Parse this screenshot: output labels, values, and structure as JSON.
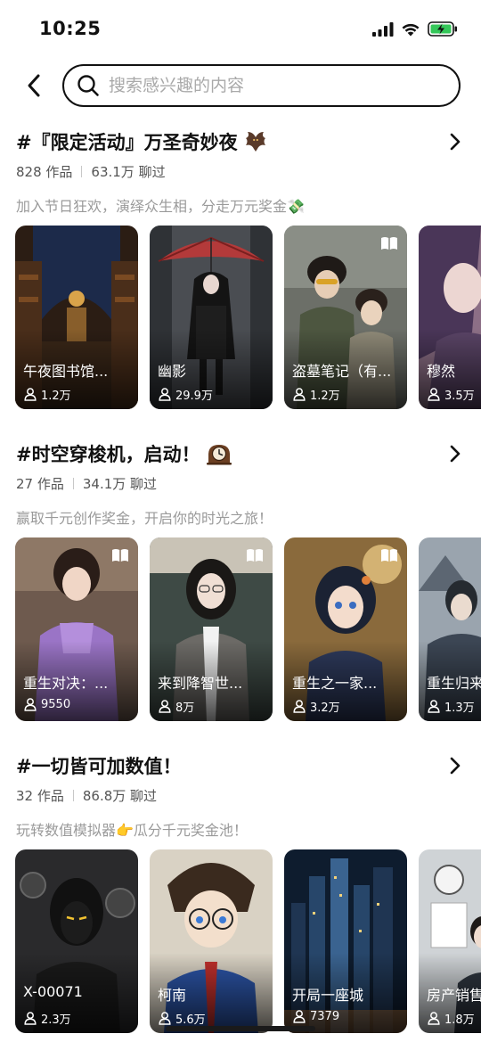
{
  "status_bar": {
    "time": "10:25"
  },
  "search": {
    "placeholder": "搜索感兴趣的内容",
    "value": ""
  },
  "topics": [
    {
      "title": "#『限定活动』万圣奇妙夜",
      "emoji_icon": "bat-icon",
      "works": "828 作品",
      "chats": "63.1万 聊过",
      "description": "加入节日狂欢，演绎众生相，分走万元奖金💸",
      "cards": [
        {
          "name": "午夜图书馆...",
          "count": "1.2万",
          "badge": false,
          "palette": "library"
        },
        {
          "name": "幽影",
          "count": "29.9万",
          "badge": false,
          "palette": "umbrella"
        },
        {
          "name": "盗墓笔记（有...",
          "count": "1.2万",
          "badge": true,
          "palette": "duo"
        },
        {
          "name": "穆然",
          "count": "3.5万",
          "badge": true,
          "palette": "mauve"
        }
      ]
    },
    {
      "title": "#时空穿梭机，启动！",
      "emoji_icon": "mantel-clock-icon",
      "works": "27 作品",
      "chats": "34.1万 聊过",
      "description": "赢取千元创作奖金，开启你的时光之旅！",
      "cards": [
        {
          "name": "重生对决：...",
          "count": "9550",
          "badge": true,
          "palette": "purple"
        },
        {
          "name": "来到降智世...",
          "count": "8万",
          "badge": true,
          "palette": "office"
        },
        {
          "name": "重生之一家...",
          "count": "3.2万",
          "badge": true,
          "palette": "gold"
        },
        {
          "name": "重生归来",
          "count": "1.3万",
          "badge": false,
          "palette": "ancient"
        }
      ]
    },
    {
      "title": "#一切皆可加数值！",
      "emoji_icon": "",
      "works": "32 作品",
      "chats": "86.8万 聊过",
      "description": "玩转数值模拟器👉瓜分千元奖金池！",
      "cards": [
        {
          "name": "X-00071",
          "count": "2.3万",
          "badge": false,
          "palette": "mech"
        },
        {
          "name": "柯南",
          "count": "5.6万",
          "badge": false,
          "palette": "conan"
        },
        {
          "name": "开局一座城",
          "count": "7379",
          "badge": false,
          "palette": "city"
        },
        {
          "name": "房产销售",
          "count": "1.8万",
          "badge": false,
          "palette": "realty"
        }
      ]
    }
  ],
  "colors": {
    "text_primary": "#111111",
    "text_secondary": "#555555",
    "text_muted": "#9a9a9a",
    "battery_green": "#34c759"
  }
}
